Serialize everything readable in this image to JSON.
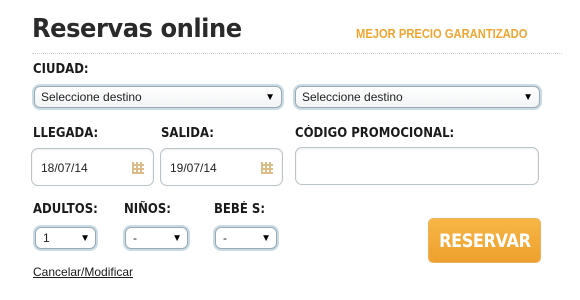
{
  "header": {
    "title": "Reservas online",
    "tagline": "MEJOR PRECIO GARANTIZADO"
  },
  "ciudad": {
    "label": "CIUDAD:",
    "origin": "Seleccione destino",
    "destination": "Seleccione destino"
  },
  "dates": {
    "llegada_label": "LLEGADA:",
    "llegada_value": "18/07/14",
    "salida_label": "SALIDA:",
    "salida_value": "19/07/14"
  },
  "promo": {
    "label": "CÓDIGO PROMOCIONAL:",
    "value": ""
  },
  "guests": {
    "adultos_label": "ADULTOS:",
    "adultos_value": "1",
    "ninos_label": "NIÑOS:",
    "ninos_value": "-",
    "bebes_label": "BEBÉ S:",
    "bebes_value": "-"
  },
  "actions": {
    "reservar_label": "RESERVAR",
    "cancel_link": "Cancelar/Modificar"
  },
  "icons": {
    "dropdown": "dropdown-arrow-icon",
    "calendar": "calendar-icon"
  },
  "colors": {
    "accent": "#f0a531",
    "button": "#f2a83a",
    "focus_ring": "#c9dbe4"
  }
}
